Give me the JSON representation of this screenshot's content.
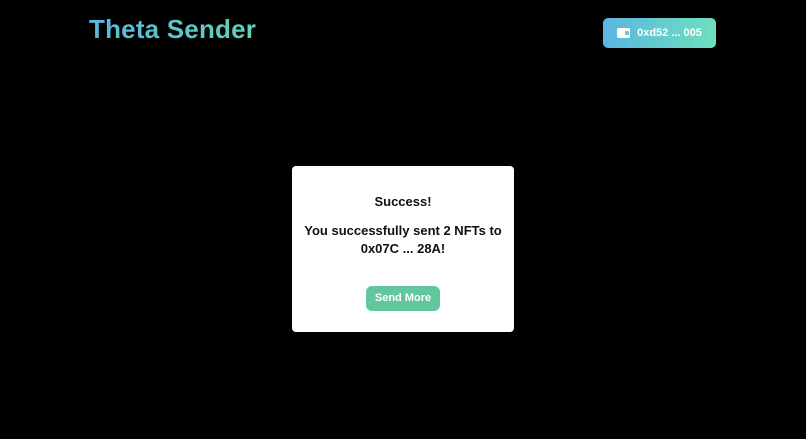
{
  "app": {
    "title": "Theta Sender"
  },
  "wallet": {
    "icon": "wallet-icon",
    "address_label": "0xd52 ... 005"
  },
  "modal": {
    "title": "Success!",
    "message": "You successfully sent 2 NFTs to 0x07C ... 28A!",
    "button_label": "Send More"
  },
  "colors": {
    "background": "#000000",
    "brand_gradient_start": "#5ab6e0",
    "brand_gradient_end": "#62d3b6",
    "button_green": "#62c79c",
    "modal_background": "#ffffff"
  }
}
